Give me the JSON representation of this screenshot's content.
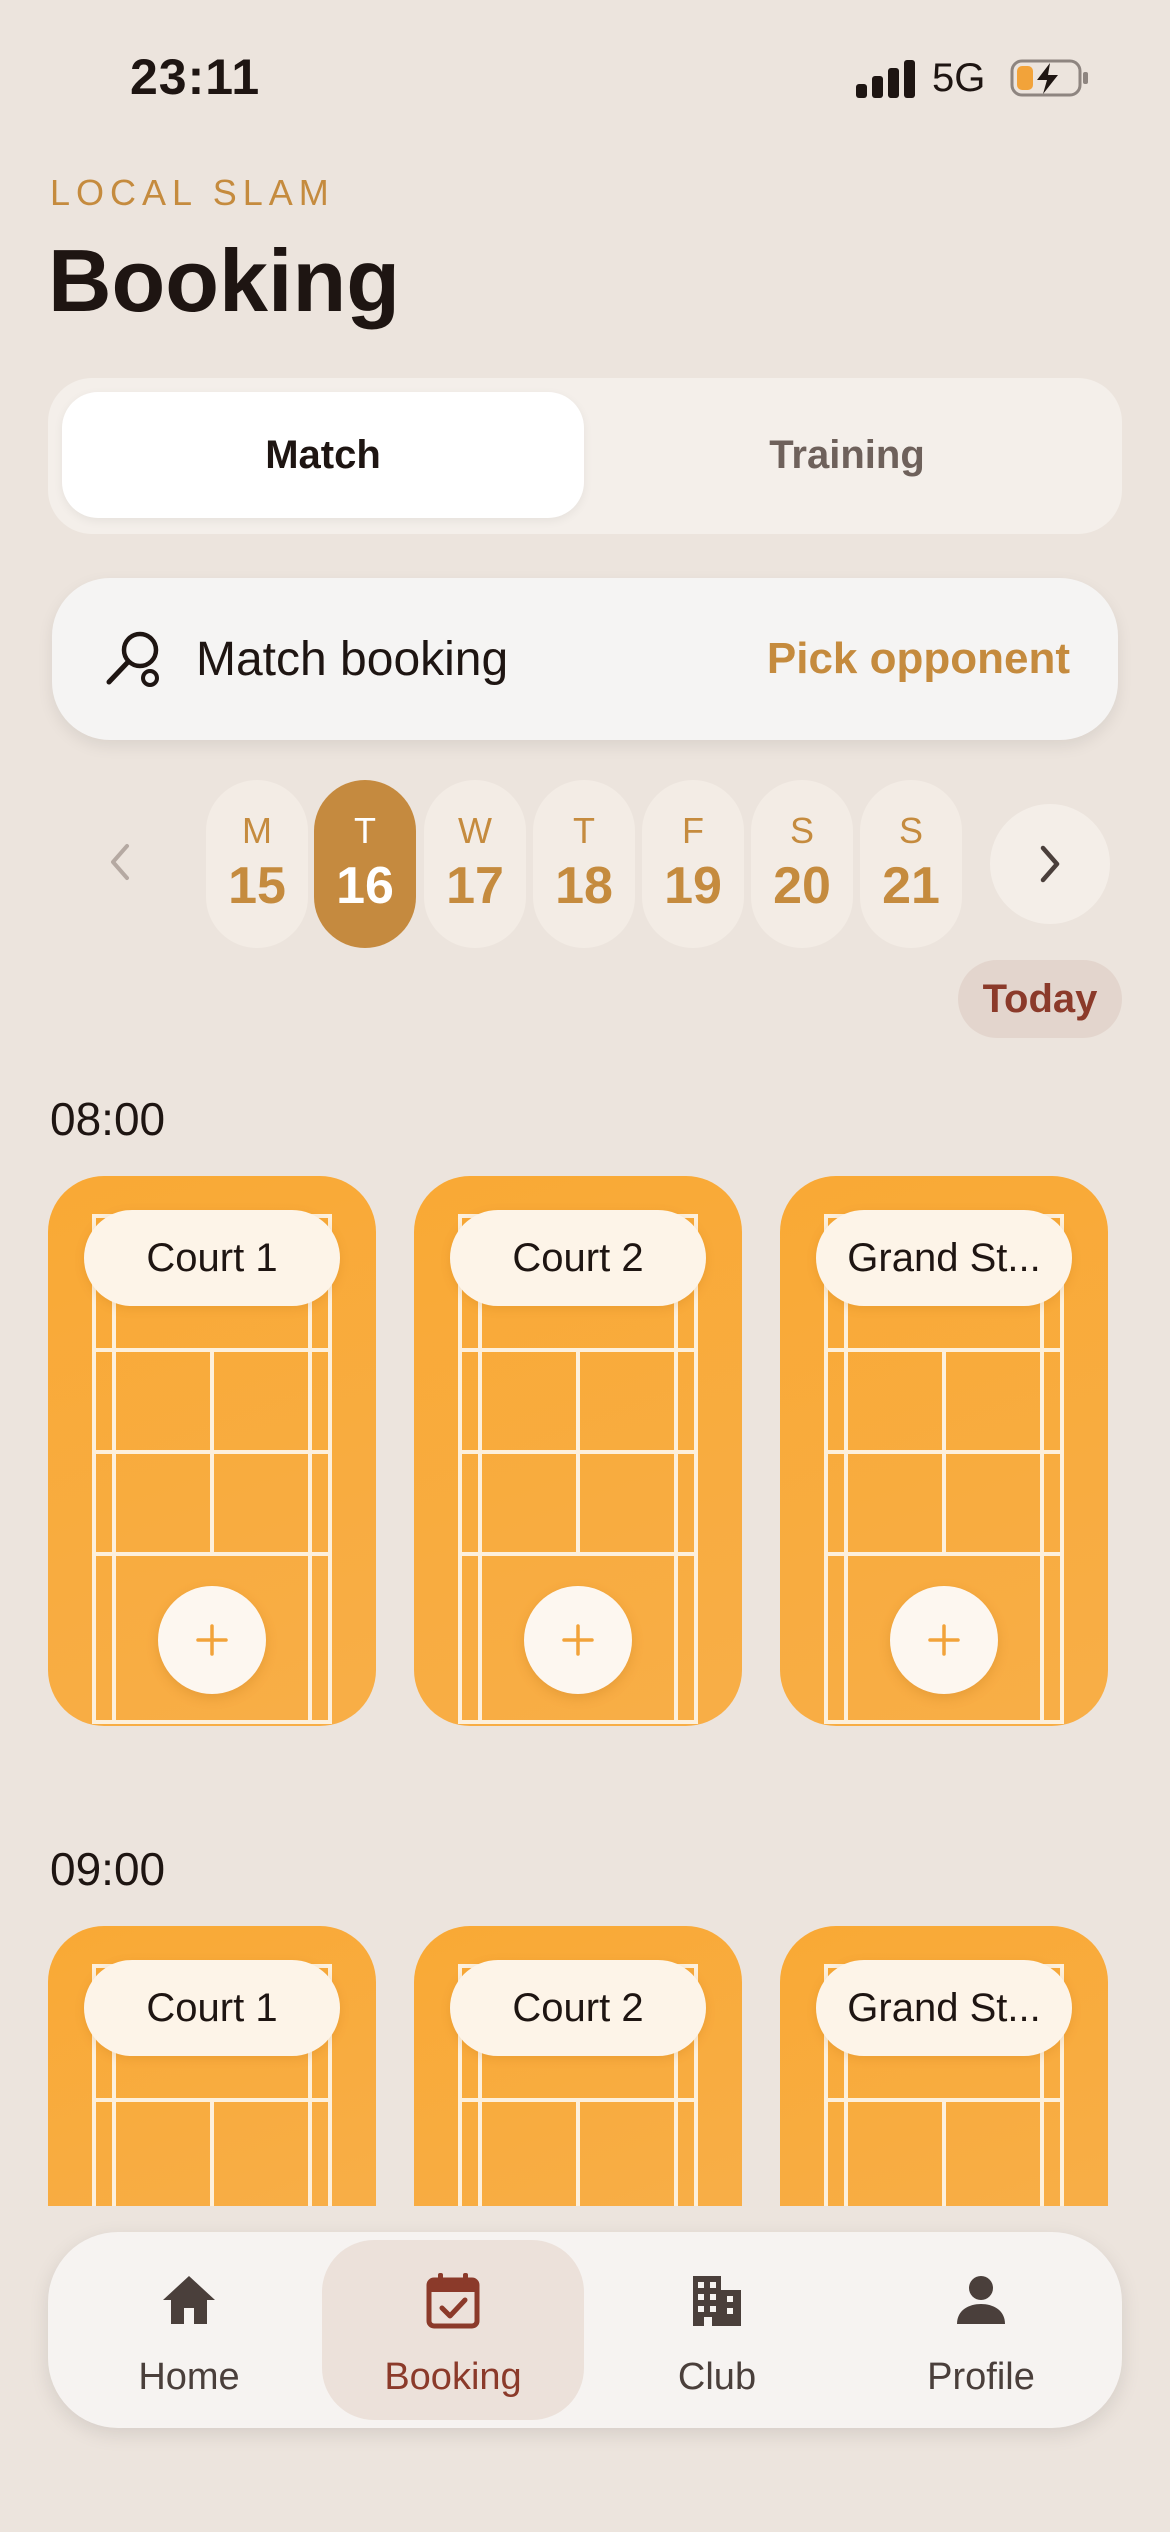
{
  "status_bar": {
    "time": "23:11",
    "network": "5G"
  },
  "header": {
    "brand": "LOCAL SLAM",
    "title": "Booking"
  },
  "mode_tabs": [
    {
      "label": "Match",
      "active": true
    },
    {
      "label": "Training",
      "active": false
    }
  ],
  "booking_bar": {
    "icon": "racket-icon",
    "label": "Match booking",
    "action": "Pick opponent"
  },
  "calendar": {
    "days": [
      {
        "dow": "M",
        "num": "15",
        "selected": false
      },
      {
        "dow": "T",
        "num": "16",
        "selected": true
      },
      {
        "dow": "W",
        "num": "17",
        "selected": false
      },
      {
        "dow": "T",
        "num": "18",
        "selected": false
      },
      {
        "dow": "F",
        "num": "19",
        "selected": false
      },
      {
        "dow": "S",
        "num": "20",
        "selected": false
      },
      {
        "dow": "S",
        "num": "21",
        "selected": false
      }
    ],
    "today_label": "Today"
  },
  "slots": [
    {
      "time": "08:00",
      "courts": [
        "Court 1",
        "Court 2",
        "Grand St..."
      ]
    },
    {
      "time": "09:00",
      "courts": [
        "Court 1",
        "Court 2",
        "Grand St..."
      ]
    }
  ],
  "bottom_nav": [
    {
      "label": "Home",
      "icon": "home-icon",
      "active": false
    },
    {
      "label": "Booking",
      "icon": "calendar-check-icon",
      "active": true
    },
    {
      "label": "Club",
      "icon": "building-icon",
      "active": false
    },
    {
      "label": "Profile",
      "icon": "person-icon",
      "active": false
    }
  ],
  "colors": {
    "background": "#ECE4DD",
    "accent": "#C58B3E",
    "court": "#F9A935",
    "nav_active": "#8B3A2A"
  }
}
